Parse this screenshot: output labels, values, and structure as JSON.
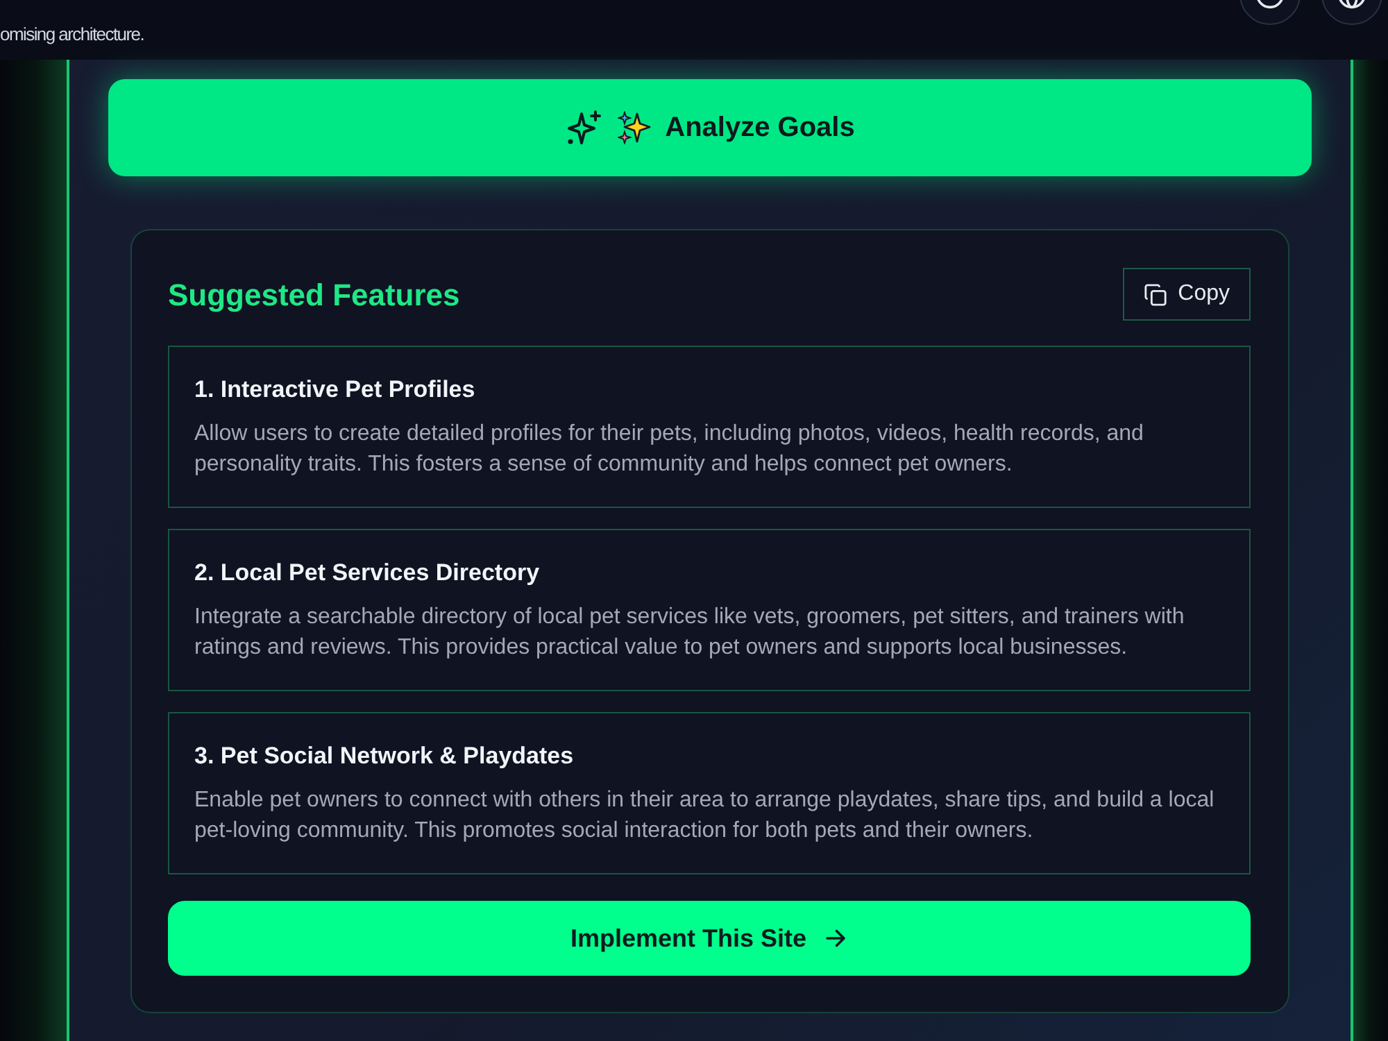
{
  "header": {
    "subtitle": "omising architecture.",
    "buttons": [
      {
        "kind": "ring"
      },
      {
        "kind": "globe"
      }
    ]
  },
  "analyze_button": {
    "label": "Analyze Goals"
  },
  "suggestions": {
    "title": "Suggested Features",
    "copy_button": {
      "label": "Copy"
    },
    "features": [
      {
        "title": "1. Interactive Pet Profiles",
        "description": "Allow users to create detailed profiles for their pets, including photos, videos, health records, and personality traits. This fosters a sense of community and helps connect pet owners."
      },
      {
        "title": "2. Local Pet Services Directory",
        "description": "Integrate a searchable directory of local pet services like vets, groomers, pet sitters, and trainers with ratings and reviews. This provides practical value to pet owners and supports local businesses."
      },
      {
        "title": "3. Pet Social Network & Playdates",
        "description": "Enable pet owners to connect with others in their area to arrange playdates, share tips, and build a local pet-loving community. This promotes social interaction for both pets and their owners."
      }
    ],
    "implement_button": {
      "label": "Implement This Site"
    }
  }
}
